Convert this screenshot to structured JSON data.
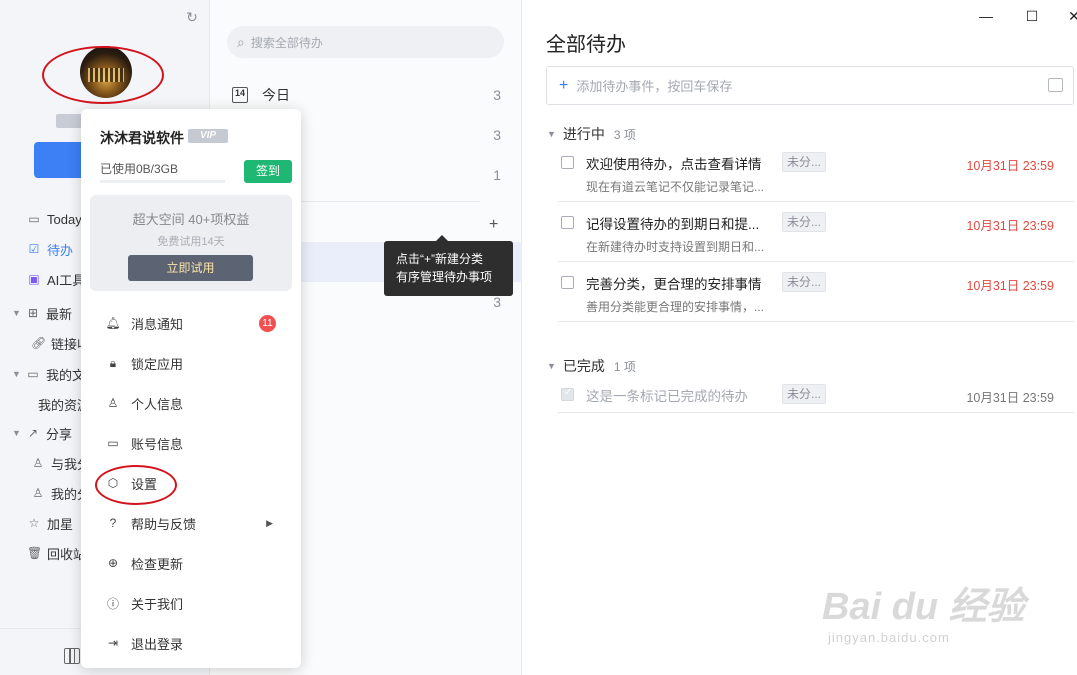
{
  "sidebar": {
    "items": [
      {
        "label": "Today",
        "icon": "calendar-icon"
      },
      {
        "label": "待办",
        "icon": "checkbox-icon"
      },
      {
        "label": "AI工具",
        "icon": "ai-icon"
      },
      {
        "label": "最新",
        "icon": "grid-icon"
      },
      {
        "label": "链接收",
        "icon": "link-icon"
      },
      {
        "label": "我的文",
        "icon": "folder-icon"
      },
      {
        "label": "我的资源",
        "icon": ""
      },
      {
        "label": "分享",
        "icon": "share-icon"
      },
      {
        "label": "与我分",
        "icon": "user-icon"
      },
      {
        "label": "我的分",
        "icon": "user-icon"
      },
      {
        "label": "加星",
        "icon": "star-icon"
      },
      {
        "label": "回收站",
        "icon": "trash-icon"
      }
    ]
  },
  "middle": {
    "search_placeholder": "搜索全部待办",
    "categories": [
      {
        "label": "今日",
        "count": "3"
      },
      {
        "label": "",
        "count": "3"
      },
      {
        "label": "",
        "count": "1"
      },
      {
        "label": "",
        "count": ""
      },
      {
        "label": "",
        "count": "3"
      }
    ]
  },
  "tooltip": {
    "line1": "点击“+”新建分类",
    "line2": "有序管理待办事项"
  },
  "main": {
    "title": "全部待办",
    "add_placeholder": "添加待办事件，按回车保存",
    "groups": {
      "in_progress": {
        "label": "进行中",
        "count": "3 项"
      },
      "done": {
        "label": "已完成",
        "count": "1 项"
      }
    },
    "tasks": [
      {
        "title": "欢迎使用待办，点击查看详情",
        "tag": "未分...",
        "due": "10月31日 23:59",
        "desc": "现在有道云笔记不仅能记录笔记..."
      },
      {
        "title": "记得设置待办的到期日和提...",
        "tag": "未分...",
        "due": "10月31日 23:59",
        "desc": "在新建待办时支持设置到期日和..."
      },
      {
        "title": "完善分类，更合理的安排事情",
        "tag": "未分...",
        "due": "10月31日 23:59",
        "desc": "善用分类能更合理的安排事情，..."
      }
    ],
    "done_tasks": [
      {
        "title": "这是一条标记已完成的待办",
        "tag": "未分...",
        "due": "10月31日 23:59"
      }
    ]
  },
  "menu": {
    "username": "沐沐君说软件",
    "vip_badge": "VIP",
    "usage": "已使用0B/3GB",
    "checkin_label": "签到",
    "promo": {
      "headline": "超大空间   40+项权益",
      "sub": "免费试用14天",
      "cta": "立即试用"
    },
    "items": [
      {
        "label": "消息通知",
        "icon": "bell-icon",
        "badge": "11"
      },
      {
        "label": "锁定应用",
        "icon": "lock-icon"
      },
      {
        "label": "个人信息",
        "icon": "person-icon"
      },
      {
        "label": "账号信息",
        "icon": "monitor-icon"
      },
      {
        "label": "设置",
        "icon": "settings-icon"
      },
      {
        "label": "帮助与反馈",
        "icon": "help-icon"
      },
      {
        "label": "检查更新",
        "icon": "update-icon"
      },
      {
        "label": "关于我们",
        "icon": "info-icon"
      },
      {
        "label": "退出登录",
        "icon": "logout-icon"
      }
    ]
  },
  "watermark": {
    "logo": "Bai du 经验",
    "url": "jingyan.baidu.com"
  },
  "colors": {
    "accent": "#3d7ff5",
    "checkin": "#1fb774",
    "due": "#e34a3f",
    "annotation": "#d3131b"
  }
}
